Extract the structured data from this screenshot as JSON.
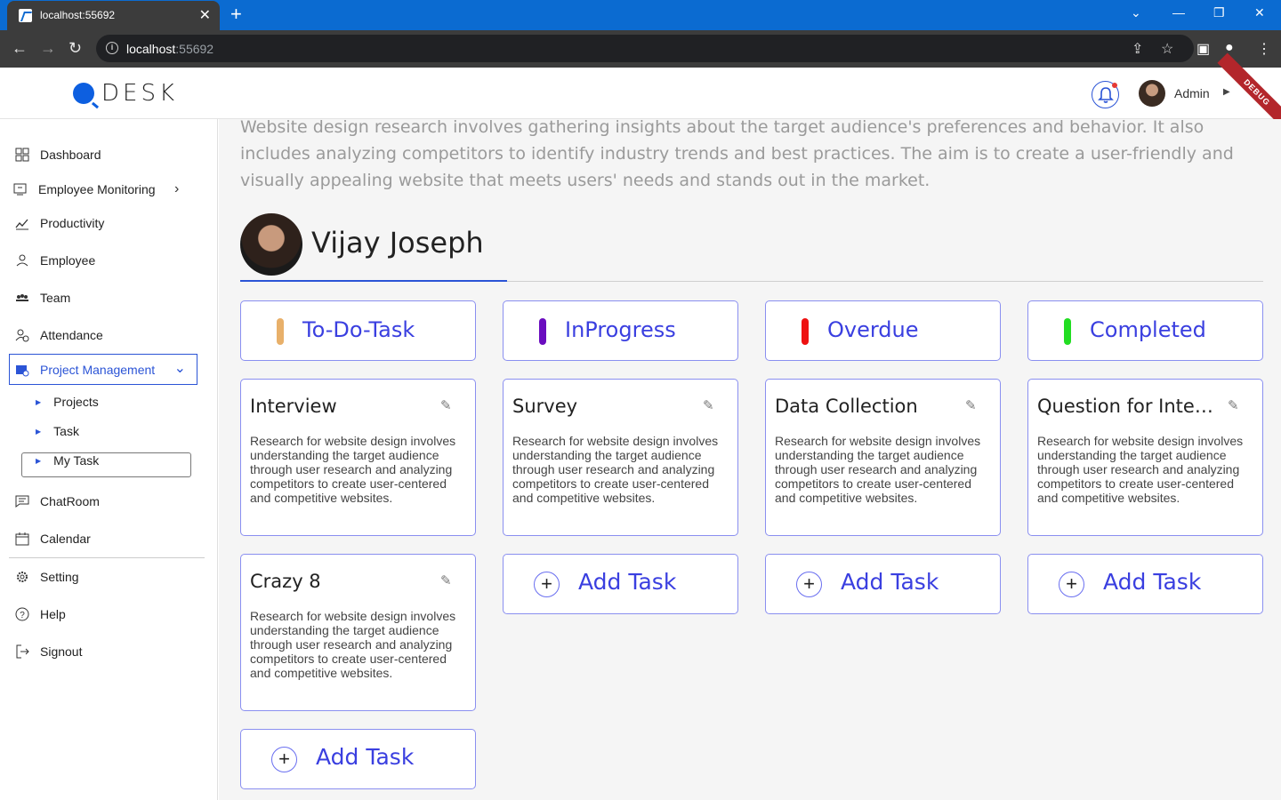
{
  "browser": {
    "tab_title": "localhost:55692",
    "url_host": "localhost",
    "url_port": ":55692"
  },
  "header": {
    "logo_text": "DESK",
    "user_name": "Admin",
    "debug_label": "DEBUG"
  },
  "sidebar": {
    "items": [
      {
        "label": "Dashboard",
        "icon": "grid-icon"
      },
      {
        "label": "Employee Monitoring",
        "icon": "monitor-icon"
      },
      {
        "label": "Productivity",
        "icon": "chart-icon"
      },
      {
        "label": "Employee",
        "icon": "person-icon"
      },
      {
        "label": "Team",
        "icon": "group-icon"
      },
      {
        "label": "Attendance",
        "icon": "attendance-icon"
      },
      {
        "label": "Project Management",
        "icon": "folder-icon"
      },
      {
        "label": "ChatRoom",
        "icon": "chat-icon"
      },
      {
        "label": "Calendar",
        "icon": "calendar-icon"
      },
      {
        "label": "Setting",
        "icon": "gear-icon"
      },
      {
        "label": "Help",
        "icon": "help-icon"
      },
      {
        "label": "Signout",
        "icon": "signout-icon"
      }
    ],
    "sub_items": [
      "Projects",
      "Task",
      "My Task"
    ],
    "accent_color": "#2b54d6"
  },
  "main": {
    "description": "Website design research involves gathering insights about the target audience's preferences and behavior. It also includes analyzing competitors to identify industry trends and best practices. The aim is to create a user-friendly and visually appealing website that meets users' needs and stands out in the market.",
    "person_name": "Vijay Joseph",
    "columns": [
      {
        "label": "To-Do-Task",
        "color": "#e8b06a"
      },
      {
        "label": "InProgress",
        "color": "#6a0dbf"
      },
      {
        "label": "Overdue",
        "color": "#ee1111"
      },
      {
        "label": "Completed",
        "color": "#22dd22"
      }
    ],
    "tasks": [
      {
        "title": "Interview",
        "desc": "Research for website design involves understanding the target audience through user research and analyzing competitors to create user-centered and competitive websites."
      },
      {
        "title": "Survey",
        "desc": "Research for website design involves understanding the target audience through user research and analyzing competitors to create user-centered and competitive websites."
      },
      {
        "title": "Data Collection",
        "desc": "Research for website design involves understanding the target audience through user research and analyzing competitors to create user-centered and competitive websites."
      },
      {
        "title": "Question for Interview",
        "desc": "Research for website design involves understanding the target audience through user research and analyzing competitors to create user-centered and competitive websites."
      },
      {
        "title": "Crazy 8",
        "desc": "Research for website design involves understanding the target audience through user research and analyzing competitors to create user-centered and competitive websites."
      }
    ],
    "add_task_label": "Add Task"
  }
}
